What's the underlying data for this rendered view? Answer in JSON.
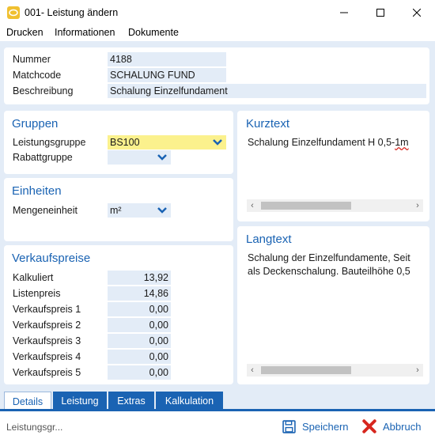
{
  "window": {
    "title": "001- Leistung ändern"
  },
  "menu": {
    "items": [
      "Drucken",
      "Informationen",
      "Dokumente"
    ]
  },
  "header": {
    "nummer_label": "Nummer",
    "nummer_value": "4188",
    "matchcode_label": "Matchcode",
    "matchcode_value": "SCHALUNG FUND",
    "beschreibung_label": "Beschreibung",
    "beschreibung_value": "Schalung Einzelfundament"
  },
  "gruppen": {
    "title": "Gruppen",
    "leistungsgruppe_label": "Leistungsgruppe",
    "leistungsgruppe_value": "BS100",
    "rabattgruppe_label": "Rabattgruppe",
    "rabattgruppe_value": ""
  },
  "einheiten": {
    "title": "Einheiten",
    "mengeneinheit_label": "Mengeneinheit",
    "mengeneinheit_value": "m²"
  },
  "verkaufspreise": {
    "title": "Verkaufspreise",
    "rows": [
      {
        "label": "Kalkuliert",
        "value": "13,92"
      },
      {
        "label": "Listenpreis",
        "value": "14,86"
      },
      {
        "label": "Verkaufspreis 1",
        "value": "0,00"
      },
      {
        "label": "Verkaufspreis 2",
        "value": "0,00"
      },
      {
        "label": "Verkaufspreis 3",
        "value": "0,00"
      },
      {
        "label": "Verkaufspreis 4",
        "value": "0,00"
      },
      {
        "label": "Verkaufspreis 5",
        "value": "0,00"
      }
    ]
  },
  "kurztext": {
    "title": "Kurztext",
    "text_before": "Schalung Einzelfundament H 0,5-",
    "text_error": "1m"
  },
  "langtext": {
    "title": "Langtext",
    "lines": [
      "Schalung der Einzelfundamente, Seit",
      "als Deckenschalung. Bauteilhöhe 0,5"
    ]
  },
  "tabs": [
    {
      "label": "Details",
      "active": true
    },
    {
      "label": "Leistung",
      "active": false
    },
    {
      "label": "Extras",
      "active": false
    },
    {
      "label": "Kalkulation",
      "active": false
    }
  ],
  "status": {
    "text": "Leistungsgr...",
    "save_label": "Speichern",
    "cancel_label": "Abbruch"
  },
  "colors": {
    "accent": "#1a63b3",
    "field_bg": "#e3ecf7",
    "highlight": "#fbf18d",
    "cancel_red": "#d7261e"
  }
}
